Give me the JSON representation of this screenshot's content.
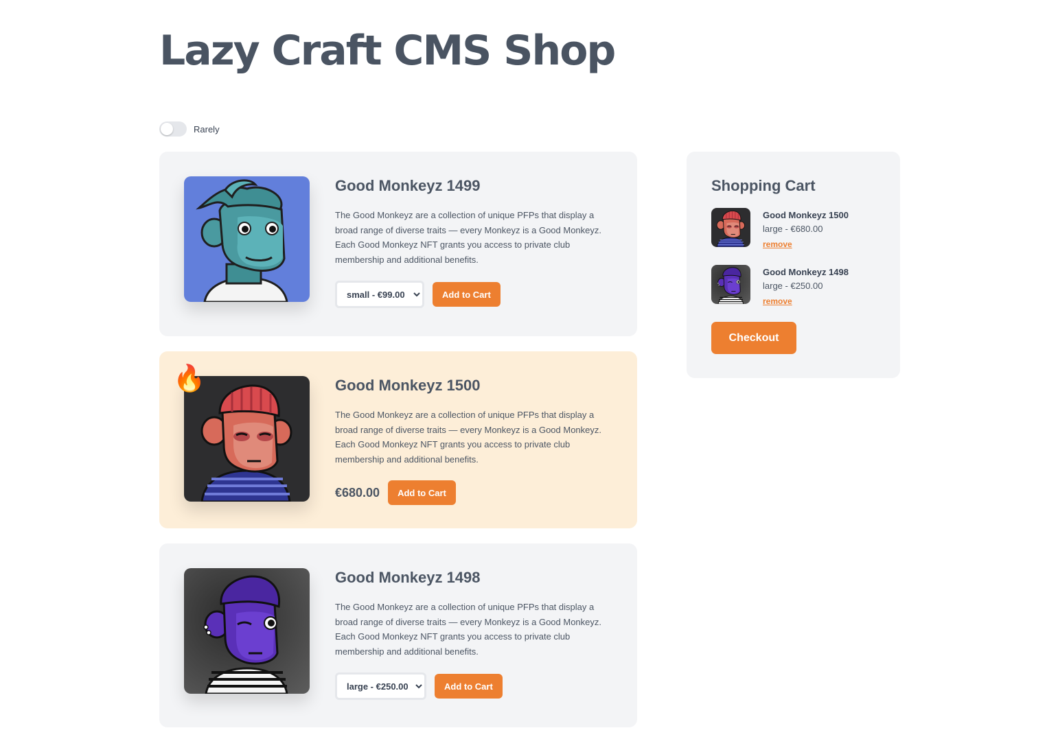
{
  "page": {
    "title": "Lazy Craft CMS Shop"
  },
  "filter": {
    "toggle_label": "Rarely",
    "toggle_on": false
  },
  "products": [
    {
      "name": "Good Monkeyz 1499",
      "description": "The Good Monkeyz are a collection of unique PFPs that display a broad range of diverse traits — every Monkeyz is a Good Monkeyz. Each Good Monkeyz NFT grants you access to private club membership and additional benefits.",
      "select_value": "small - €99.00",
      "button_label": "Add to Cart",
      "image_icon": "teal-monkey-avatar"
    },
    {
      "name": "Good Monkeyz 1500",
      "description": "The Good Monkeyz are a collection of unique PFPs that display a broad range of diverse traits — every Monkeyz is a Good Monkeyz. Each Good Monkeyz NFT grants you access to private club membership and additional benefits.",
      "price": "€680.00",
      "button_label": "Add to Cart",
      "badge": "🔥",
      "image_icon": "red-monkey-avatar"
    },
    {
      "name": "Good Monkeyz 1498",
      "description": "The Good Monkeyz are a collection of unique PFPs that display a broad range of diverse traits — every Monkeyz is a Good Monkeyz. Each Good Monkeyz NFT grants you access to private club membership and additional benefits.",
      "select_value": "large - €250.00",
      "button_label": "Add to Cart",
      "image_icon": "purple-monkey-avatar"
    }
  ],
  "cart": {
    "title": "Shopping Cart",
    "items": [
      {
        "name": "Good Monkeyz 1500",
        "price": "large - €680.00",
        "remove_label": "remove"
      },
      {
        "name": "Good Monkeyz 1498",
        "price": "large - €250.00",
        "remove_label": "remove"
      }
    ],
    "checkout_label": "Checkout"
  },
  "colors": {
    "accent": "#ed7f30",
    "card_bg": "#f3f4f6",
    "hot_card_bg": "#fdeed8",
    "text": "#4b5563"
  }
}
